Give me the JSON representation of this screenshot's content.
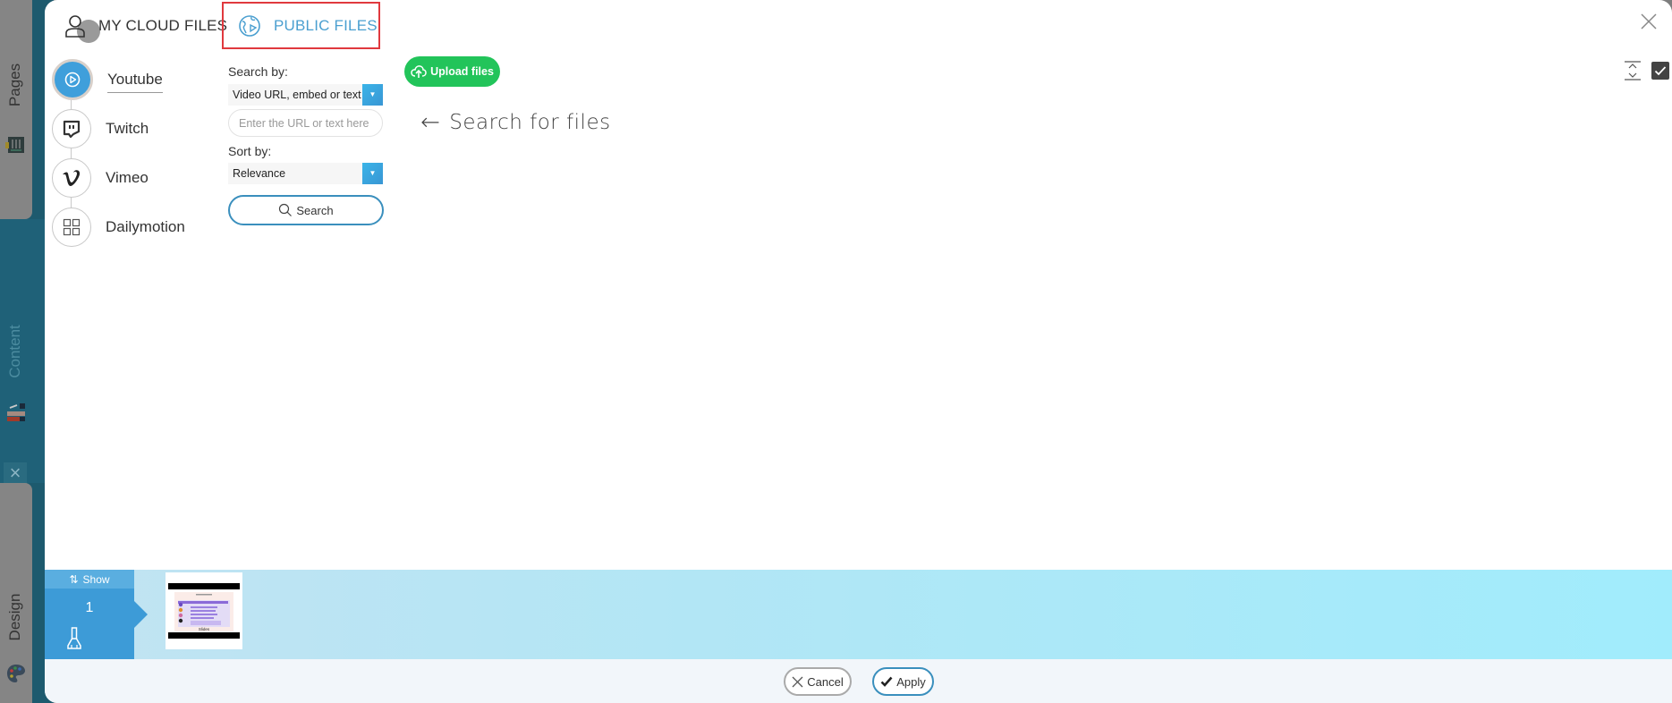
{
  "sidebar": {
    "tabs": [
      {
        "label": "Pages",
        "icon": "pages-icon",
        "state": "inactive"
      },
      {
        "label": "Content",
        "icon": "content-icon",
        "state": "active"
      },
      {
        "label": "Design",
        "icon": "palette-icon",
        "state": "inactive"
      }
    ]
  },
  "modal": {
    "tabs": [
      {
        "label": "MY CLOUD FILES",
        "icon": "user-icon",
        "active": false
      },
      {
        "label": "PUBLIC FILES",
        "icon": "globe-icon",
        "active": true
      }
    ],
    "platforms": [
      {
        "label": "Youtube",
        "icon": "youtube-play-icon",
        "active": true
      },
      {
        "label": "Twitch",
        "icon": "twitch-icon",
        "active": false
      },
      {
        "label": "Vimeo",
        "icon": "vimeo-icon",
        "active": false
      },
      {
        "label": "Dailymotion",
        "icon": "grid-icon",
        "active": false
      }
    ],
    "search": {
      "search_by_label": "Search by:",
      "search_by_value": "Video URL, embed or text",
      "input_placeholder": "Enter the URL or text here",
      "input_value": "",
      "sort_by_label": "Sort by:",
      "sort_by_value": "Relevance",
      "search_button": "Search"
    },
    "upload_button": "Upload files",
    "hint": {
      "arrow": "←",
      "text": "Search for files"
    }
  },
  "strip": {
    "show_label": "Show",
    "slide_number": "1",
    "thumbnail": {
      "caption": "Slides"
    }
  },
  "footer": {
    "cancel": "Cancel",
    "apply": "Apply"
  },
  "colors": {
    "accent_blue": "#3d9bd7",
    "upload_green": "#22c45a",
    "highlight_red": "#e0393e",
    "public_tab_blue": "#4a9fd0"
  }
}
